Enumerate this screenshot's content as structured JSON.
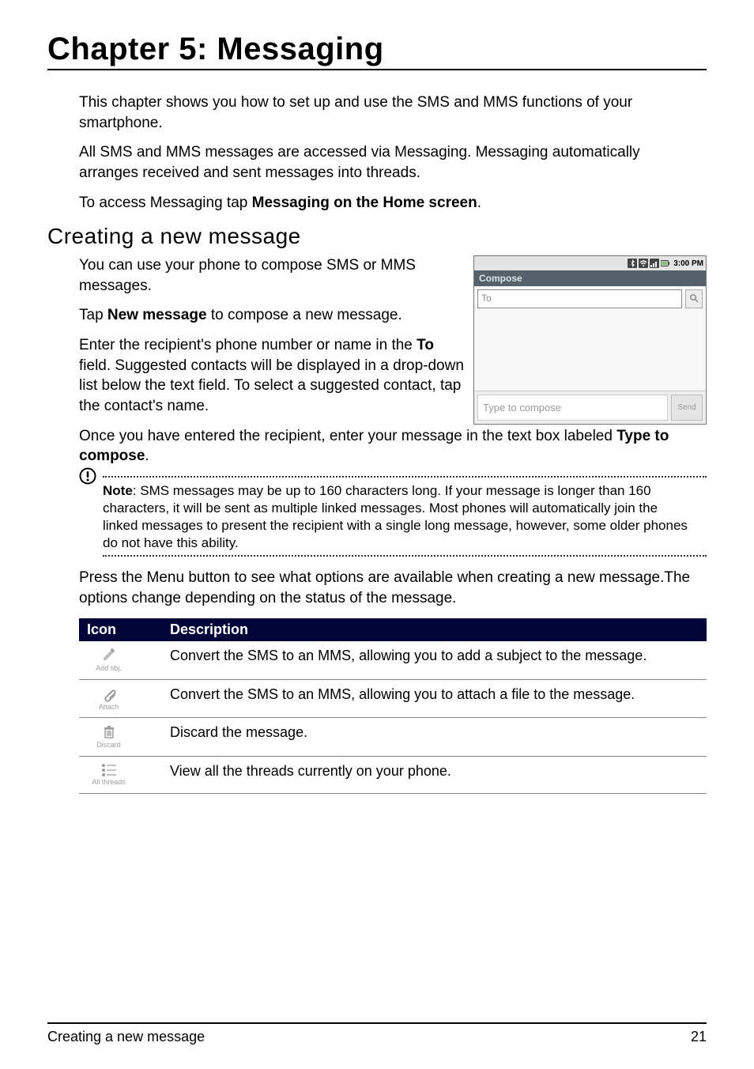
{
  "chapter_title": "Chapter 5: Messaging",
  "intro": {
    "p1": "This chapter shows you how to set up and use the SMS and MMS functions of your smartphone.",
    "p2": "All SMS and MMS messages are accessed via Messaging. Messaging automatically arranges received and sent messages into threads.",
    "p3a": "To access Messaging tap ",
    "p3b": "Messaging on the Home screen",
    "p3c": "."
  },
  "section_title": "Creating a new message",
  "creating": {
    "p1": "You can use your phone to compose SMS or MMS messages.",
    "p2a": "Tap ",
    "p2b": "New message",
    "p2c": " to compose a new message.",
    "p3a": "Enter the recipient's phone number or name in the ",
    "p3b": "To",
    "p3c": " field. Suggested contacts will be displayed in a drop-down list below the text field. To select a suggested contact, tap the contact's name.",
    "p4a": "Once you have entered the recipient, enter your message in the text box labeled ",
    "p4b": "Type to compose",
    "p4c": "."
  },
  "screenshot": {
    "time": "3:00 PM",
    "app_title": "Compose",
    "to_placeholder": "To",
    "type_placeholder": "Type to compose",
    "send_label": "Send"
  },
  "note": {
    "label": "Note",
    "text": ": SMS messages may be up to 160 characters long. If your message is longer than 160 characters, it will be sent as multiple linked messages. Most phones will automatically join the linked messages to present the recipient with a single long message, however, some older phones do not have this ability."
  },
  "menu_paragraph": "Press the Menu button to see what options are available when creating a new message.The options change depending on the status of the message.",
  "table": {
    "headers": {
      "icon": "Icon",
      "desc": "Description"
    },
    "rows": [
      {
        "iconLabel": "Add sbj.",
        "desc": "Convert the SMS to an MMS, allowing you to add a subject to the message."
      },
      {
        "iconLabel": "Attach",
        "desc": "Convert the SMS to an MMS, allowing you to attach a file to the message."
      },
      {
        "iconLabel": "Discard",
        "desc": "Discard the message."
      },
      {
        "iconLabel": "All threads",
        "desc": "View all the threads currently on your phone."
      }
    ]
  },
  "footer": {
    "section": "Creating a new message",
    "page": "21"
  }
}
